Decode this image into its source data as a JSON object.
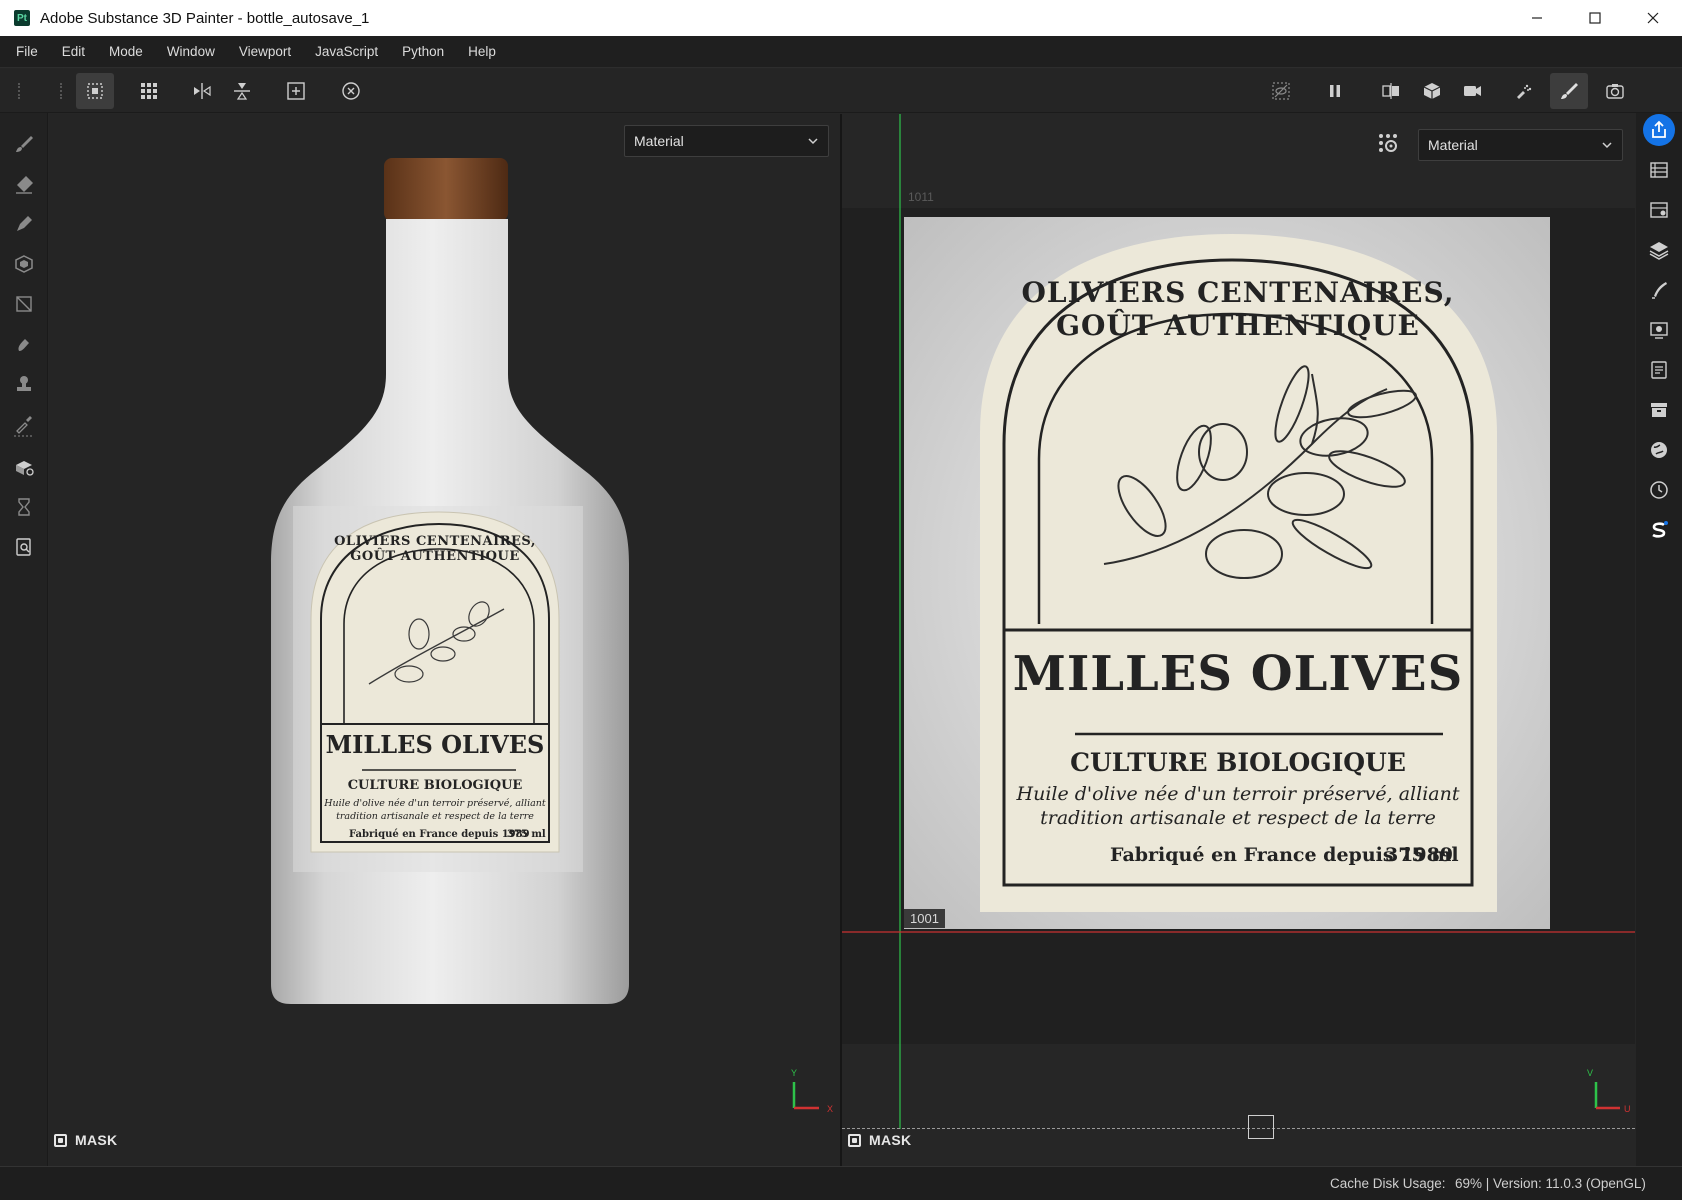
{
  "window": {
    "app_icon": "Pt",
    "title": "Adobe Substance 3D Painter - bottle_autosave_1",
    "controls": [
      "minimize-icon",
      "maximize-icon",
      "close-icon"
    ]
  },
  "menu": [
    "File",
    "Edit",
    "Mode",
    "Window",
    "Viewport",
    "JavaScript",
    "Python",
    "Help"
  ],
  "viewport3d": {
    "mode_select": "Material",
    "mask_label": "MASK",
    "gizmo": {
      "y": "Y",
      "x": "X"
    }
  },
  "viewport2d": {
    "mode_select": "Material",
    "mask_label": "MASK",
    "udim_top": "1011",
    "udim_bottom": "1001",
    "gizmo": {
      "v": "V",
      "u": "U"
    }
  },
  "label": {
    "arc_text": "OLIVIERS CENTENAIRES, GOÛT AUTHENTIQUE",
    "brand": "MILLES OLIVES",
    "subtitle": "CULTURE BIOLOGIQUE",
    "description_line1": "Huile d'olive née d'un terroir préservé, alliant",
    "description_line2": "tradition artisanale et respect de la terre",
    "origin": "Fabriqué en France depuis 1989",
    "volume": "375 ml"
  },
  "status": {
    "cache_label": "Cache Disk Usage:",
    "cache_value": "69% | Version: 11.0.3 (OpenGL)"
  },
  "colors": {
    "accent": "#1473e6",
    "label_paper": "#ece8d9",
    "ink": "#232323",
    "cork": "#7a4a2a",
    "uv_x_axis": "#d03232",
    "uv_y_axis": "#2ec24a"
  }
}
